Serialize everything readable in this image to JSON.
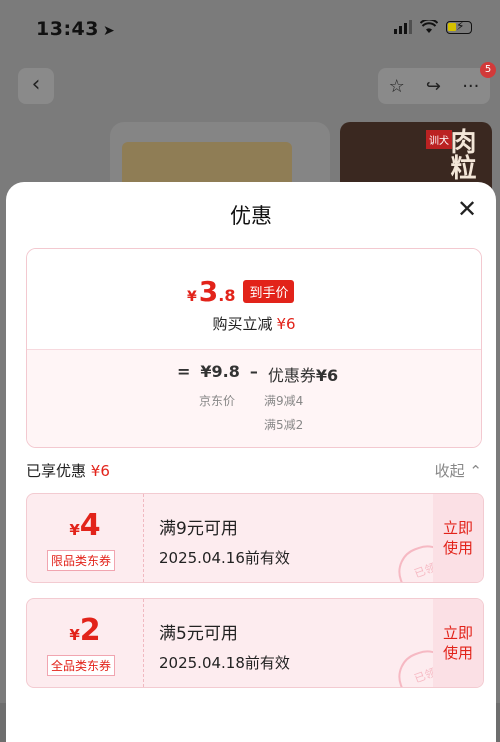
{
  "status": {
    "time": "13:43",
    "location_icon": "location-arrow-icon",
    "signal_icon": "signal-icon",
    "wifi_icon": "wifi-icon",
    "battery_icon": "battery-charging-icon"
  },
  "background": {
    "back_icon": "chevron-left-icon",
    "star_icon": "star-icon",
    "share_icon": "share-icon",
    "more_icon": "more-icon",
    "badge_count": "5",
    "thumb_text": "肉粒",
    "thumb_tag": "训犬"
  },
  "sheet": {
    "title": "优惠",
    "close_icon": "close-icon"
  },
  "price": {
    "currency": "¥",
    "final_int": "3",
    "final_dec": ".8",
    "final_tag": "到手价",
    "reduce_label": "购买立减",
    "reduce_amount": "¥6",
    "equals": "=",
    "base_price": "¥9.8",
    "minus": "–",
    "coupon_label": "优惠券",
    "coupon_amount": "¥6",
    "base_price_label": "京东价",
    "condition_1": "满9减4",
    "condition_2": "满5减2"
  },
  "enjoyed": {
    "label": "已享优惠",
    "amount": "¥6",
    "collapse_label": "收起",
    "collapse_icon": "chevron-up-icon"
  },
  "coupons": [
    {
      "currency": "¥",
      "value": "4",
      "type": "限品类东券",
      "condition": "满9元可用",
      "validity": "2025.04.16前有效",
      "action": "立即\n使用",
      "stamp": "已领"
    },
    {
      "currency": "¥",
      "value": "2",
      "type": "全品类东券",
      "condition": "满5元可用",
      "validity": "2025.04.18前有效",
      "action": "立即\n使用",
      "stamp": "已领"
    }
  ],
  "colors": {
    "accent_red": "#e2231a",
    "coupon_bg": "#fdecef"
  }
}
